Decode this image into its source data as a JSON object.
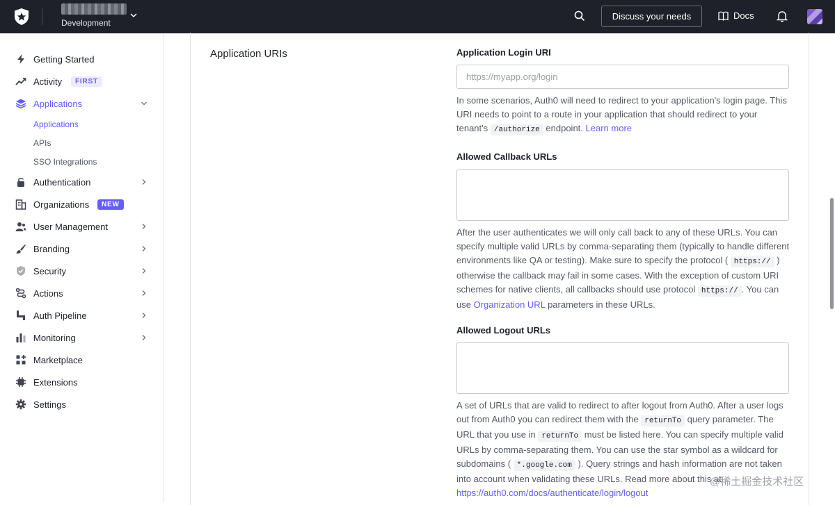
{
  "topbar": {
    "tenant_env": "Development",
    "discuss_label": "Discuss your needs",
    "docs_label": "Docs"
  },
  "sidebar": {
    "items": [
      {
        "label": "Getting Started"
      },
      {
        "label": "Activity",
        "badge": "FIRST"
      },
      {
        "label": "Applications",
        "active": true
      },
      {
        "label": "Authentication"
      },
      {
        "label": "Organizations",
        "badge": "NEW"
      },
      {
        "label": "User Management"
      },
      {
        "label": "Branding"
      },
      {
        "label": "Security"
      },
      {
        "label": "Actions"
      },
      {
        "label": "Auth Pipeline"
      },
      {
        "label": "Monitoring"
      },
      {
        "label": "Marketplace"
      },
      {
        "label": "Extensions"
      },
      {
        "label": "Settings"
      }
    ],
    "sub_items": [
      {
        "label": "Applications",
        "active": true
      },
      {
        "label": "APIs"
      },
      {
        "label": "SSO Integrations"
      }
    ]
  },
  "main": {
    "section_title": "Application URIs",
    "login_uri": {
      "label": "Application Login URI",
      "placeholder": "https://myapp.org/login",
      "help_1": "In some scenarios, Auth0 will need to redirect to your application's login page. This URI needs to point to a route in your application that should redirect to your tenant's",
      "help_code": "/authorize",
      "help_2": "endpoint.",
      "help_link": "Learn more"
    },
    "callback_urls": {
      "label": "Allowed Callback URLs",
      "value": "",
      "help_1": "After the user authenticates we will only call back to any of these URLs. You can specify multiple valid URLs by comma-separating them (typically to handle different environments like QA or testing). Make sure to specify the protocol (",
      "help_code_1": "https://",
      "help_2": ") otherwise the callback may fail in some cases. With the exception of custom URI schemes for native clients, all callbacks should use protocol",
      "help_code_2": "https://",
      "help_3": ". You can use",
      "help_link": "Organization URL",
      "help_4": "parameters in these URLs."
    },
    "logout_urls": {
      "label": "Allowed Logout URLs",
      "value": "",
      "help_1": "A set of URLs that are valid to redirect to after logout from Auth0. After a user logs out from Auth0 you can redirect them with the",
      "help_code_1": "returnTo",
      "help_2": "query parameter. The URL that you use in",
      "help_code_2": "returnTo",
      "help_3": "must be listed here. You can specify multiple valid URLs by comma-separating them. You can use the star symbol as a wildcard for subdomains (",
      "help_code_3": "*.google.com",
      "help_4": "). Query strings and hash information are not taken into account when validating these URLs. Read more about this at",
      "help_link": "https://auth0.com/docs/authenticate/login/logout"
    }
  },
  "watermark": "@稀土掘金技术社区",
  "colors": {
    "accent": "#635dff",
    "topbar_bg": "#1e212a",
    "text_muted": "#545963"
  }
}
